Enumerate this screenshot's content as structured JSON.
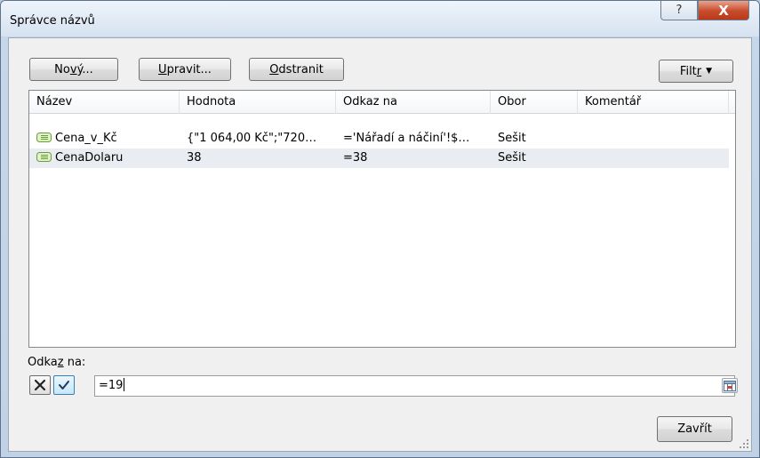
{
  "window": {
    "title": "Správce názvů",
    "help_symbol": "?",
    "close_symbol": "X"
  },
  "toolbar": {
    "new_label_pre": "No",
    "new_label_u": "v",
    "new_label_post": "ý...",
    "edit_label_u": "U",
    "edit_label_post": "pravit...",
    "delete_label_u": "O",
    "delete_label_post": "dstranit",
    "filter_label_pre": "Filt",
    "filter_label_u": "r"
  },
  "list": {
    "columns": [
      "Název",
      "Hodnota",
      "Odkaz na",
      "Obor",
      "Komentář"
    ],
    "rows": [
      {
        "name": "Cena_v_Kč",
        "value": "{\"1 064,00 Kč\";\"720…",
        "refers_to": "='Nářadí a náčiní'!$…",
        "scope": "Sešit",
        "comment": ""
      },
      {
        "name": "CenaDolaru",
        "value": "38",
        "refers_to": "=38",
        "scope": "Sešit",
        "comment": ""
      }
    ]
  },
  "refers_to": {
    "label_pre": "Odka",
    "label_u": "z",
    "label_post": " na:",
    "value": "=19"
  },
  "footer": {
    "close_label": "Zavřít"
  },
  "colors": {
    "title_gradient_top": "#eef4fb",
    "close_button_red": "#c84b2b",
    "selected_row": "#e9ecf1"
  }
}
